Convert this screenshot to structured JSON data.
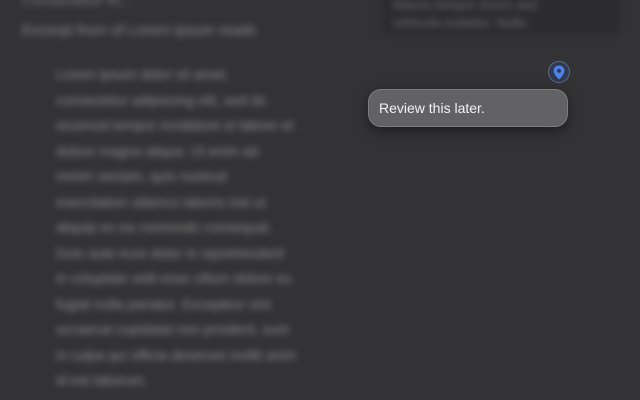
{
  "document": {
    "top_fragment": "Consectetur et...",
    "heading": "Excerpt from of Lorem ipsum reads",
    "side_box_text": "Mauris tempor lorem sed\nvehicula sodales. Nulla",
    "body_lines": [
      "Lorem ipsum dolor sit amet,",
      "consectetur adipiscing elit, sed do",
      "eiusmod tempor incididunt ut labore et",
      "dolore magna aliqua. Ut enim ad",
      "minim veniam, quis nostrud",
      "exercitation ullamco laboris nisi ut",
      "aliquip ex ea commodo consequat.",
      "Duis aute irure dolor in reprehenderit",
      "in voluptate velit esse cillum dolore eu",
      "fugiat nulla pariatur. Excepteur sint",
      "occaecat cupidatat non proident, sunt",
      "in culpa qui officia deserunt mollit anim",
      "id est laborum."
    ]
  },
  "annotation": {
    "pin_icon": "location-pin-icon",
    "pin_color": "#4f82e8",
    "note_text": "Review this later."
  }
}
